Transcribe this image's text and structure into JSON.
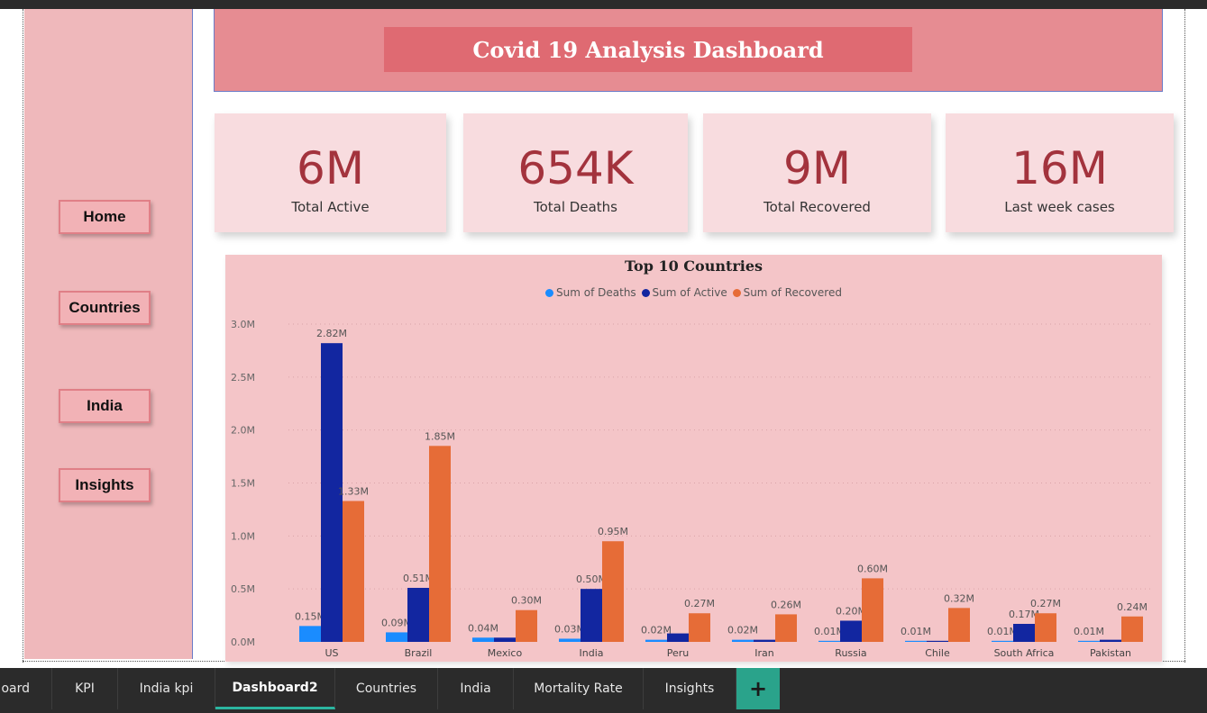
{
  "window": {
    "sidebar_nav": [
      {
        "label": "Home"
      },
      {
        "label": "Countries"
      },
      {
        "label": "India"
      },
      {
        "label": "Insights"
      }
    ],
    "banner": {
      "title": "Covid 19 Analysis Dashboard"
    },
    "kpis": [
      {
        "value": "6M",
        "label": "Total Active"
      },
      {
        "value": "654K",
        "label": "Total Deaths"
      },
      {
        "value": "9M",
        "label": "Total Recovered"
      },
      {
        "value": "16M",
        "label": "Last week cases"
      }
    ],
    "tabs": [
      {
        "label": "oard"
      },
      {
        "label": "KPI"
      },
      {
        "label": "India kpi"
      },
      {
        "label": "Dashboard2",
        "active": true
      },
      {
        "label": "Countries"
      },
      {
        "label": "India"
      },
      {
        "label": "Mortality Rate"
      },
      {
        "label": "Insights"
      }
    ],
    "add_tab_icon": "plus-icon",
    "colors": {
      "sidebar": "#efb8bb",
      "banner": "#e68c92",
      "banner_title_box": "#df6a72",
      "kpi_card": "#f8dcdf",
      "kpi_value": "#a3333d",
      "chart_bg": "#f4c5c8",
      "active_tab_underline": "#2bb5a0",
      "add_tab": "#2aa38b"
    }
  },
  "chart_data": {
    "type": "bar",
    "title": "Top 10 Countries",
    "categories": [
      "US",
      "Brazil",
      "Mexico",
      "India",
      "Peru",
      "Iran",
      "Russia",
      "Chile",
      "South Africa",
      "Pakistan"
    ],
    "series": [
      {
        "name": "Sum of Deaths",
        "color": "#1a8cff",
        "values": [
          0.15,
          0.09,
          0.04,
          0.03,
          0.02,
          0.02,
          0.01,
          0.01,
          0.01,
          0.01
        ],
        "labels": [
          "0.15M",
          "0.09M",
          "0.04M",
          "0.03M",
          "0.02M",
          "0.02M",
          "0.01M",
          "0.01M",
          "0.01M",
          "0.01M"
        ]
      },
      {
        "name": "Sum of Active",
        "color": "#1226a0",
        "values": [
          2.82,
          0.51,
          0.04,
          0.5,
          0.08,
          0.02,
          0.2,
          0.01,
          0.17,
          0.02
        ],
        "labels": [
          "2.82M",
          "0.51M",
          "",
          "0.50M",
          "",
          "",
          "0.20M",
          "",
          "0.17M",
          ""
        ]
      },
      {
        "name": "Sum of Recovered",
        "color": "#e66c37",
        "values": [
          1.33,
          1.85,
          0.3,
          0.95,
          0.27,
          0.26,
          0.6,
          0.32,
          0.27,
          0.24
        ],
        "labels": [
          "1.33M",
          "1.85M",
          "0.30M",
          "0.95M",
          "0.27M",
          "0.26M",
          "0.60M",
          "0.32M",
          "0.27M",
          "0.24M"
        ]
      }
    ],
    "yticks": [
      "0.0M",
      "0.5M",
      "1.0M",
      "1.5M",
      "2.0M",
      "2.5M",
      "3.0M"
    ],
    "ylim": [
      0,
      3.0
    ],
    "grid": true,
    "legend_position": "top-center"
  }
}
